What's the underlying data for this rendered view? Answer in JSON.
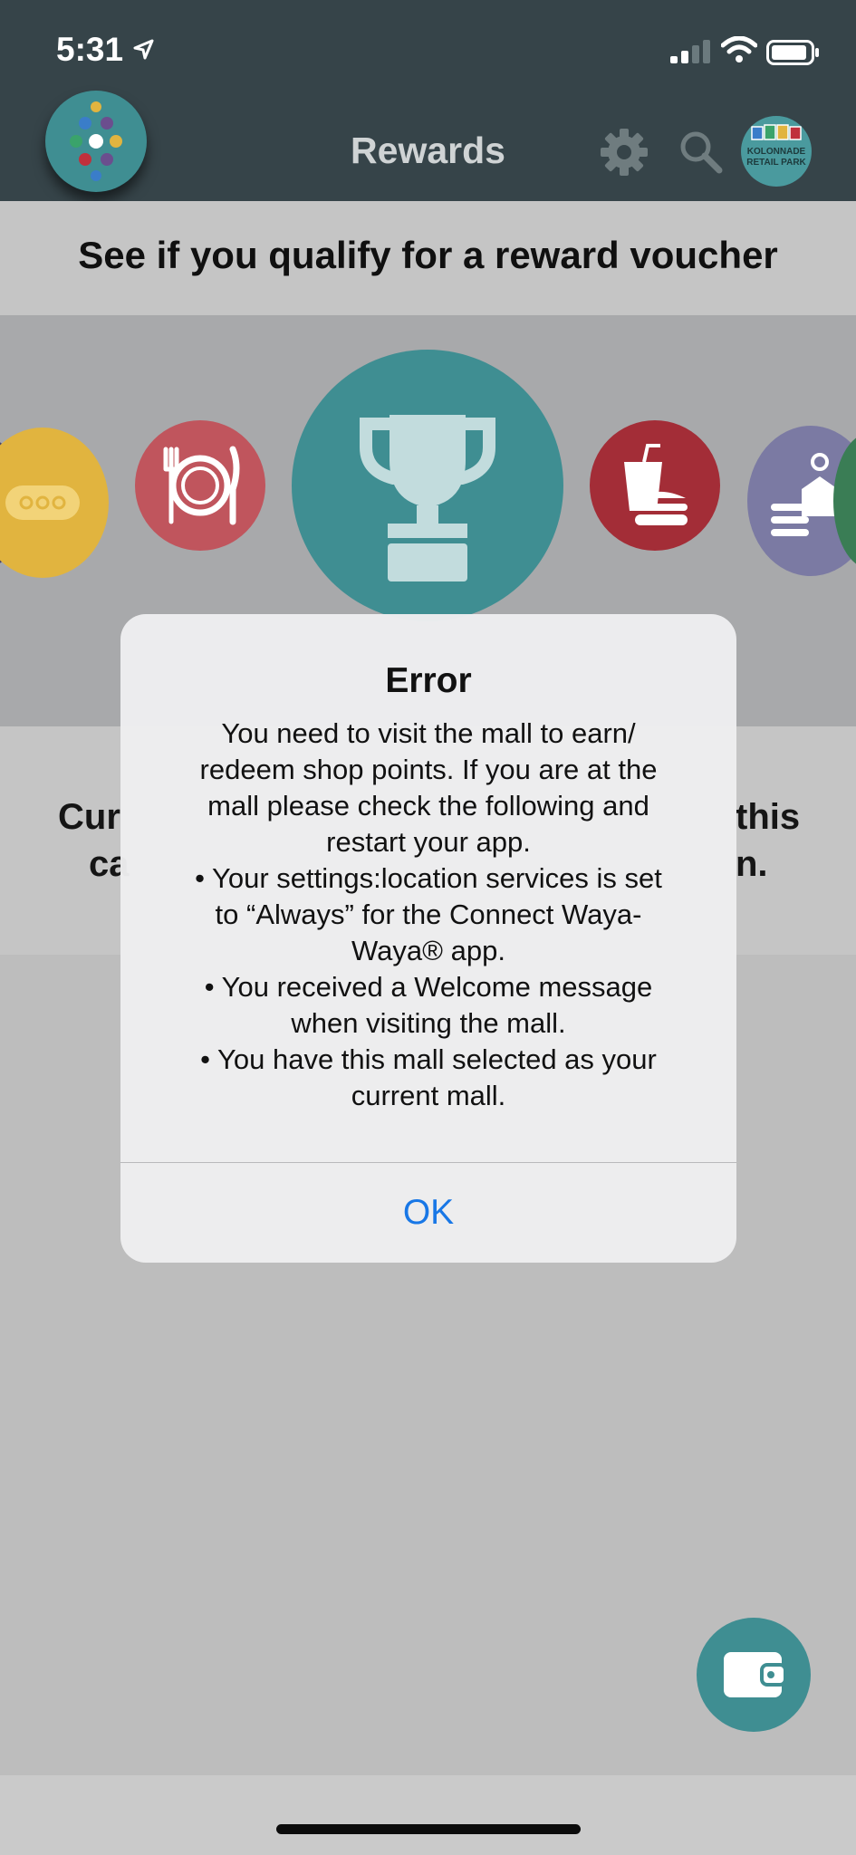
{
  "status_bar": {
    "time": "5:31"
  },
  "nav": {
    "title": "Rewards",
    "mall_logo_text": "KOLONNADE RETAIL PARK"
  },
  "banner": {
    "text": "See if you qualify for a reward voucher"
  },
  "background_text": {
    "line1_left": "Cur",
    "line1_right": "this",
    "line2_left": "ca",
    "line2_right": "n."
  },
  "categories": [
    {
      "icon": "more-icon",
      "color": "#e1b43f"
    },
    {
      "icon": "dining-icon",
      "color": "#c0555d"
    },
    {
      "icon": "trophy-icon",
      "color": "#3f8e92"
    },
    {
      "icon": "fast-food-icon",
      "color": "#a32d37"
    },
    {
      "icon": "services-icon",
      "color": "#7b7aa3"
    }
  ],
  "alert": {
    "title": "Error",
    "message_lines": [
      "You need to visit the mall to earn/",
      "redeem shop points. If you are at the",
      "mall please check the following and",
      "restart your app.",
      "• Your settings:location services is set",
      "to “Always” for the Connect Waya-",
      "Waya® app.",
      "• You received a Welcome message",
      "when visiting the mall.",
      "• You have this mall selected as your",
      "current mall."
    ],
    "ok_label": "OK"
  },
  "colors": {
    "teal": "#3f8e92",
    "header": "#364449",
    "link_blue": "#1877e6"
  }
}
